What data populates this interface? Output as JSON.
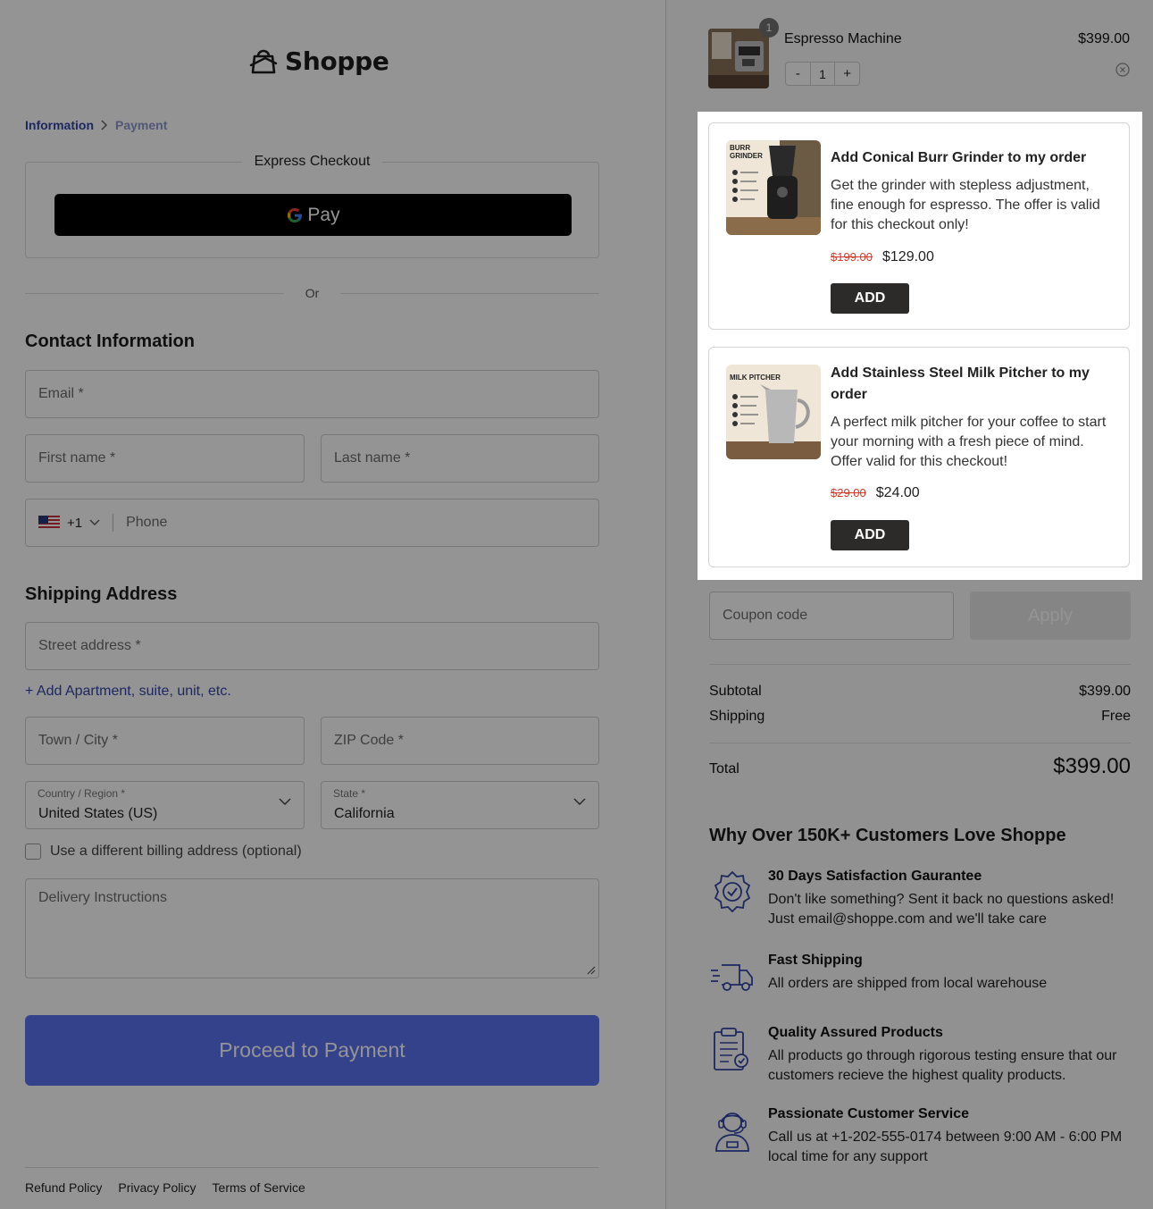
{
  "brand": {
    "name": "Shoppe",
    "accent": "#3346a6"
  },
  "breadcrumb": {
    "step1": "Information",
    "step2": "Payment"
  },
  "express": {
    "title": "Express Checkout",
    "gpay_label": "Pay",
    "or_label": "Or"
  },
  "contact": {
    "title": "Contact Information",
    "email_placeholder": "Email *",
    "first_name_placeholder": "First name *",
    "last_name_placeholder": "Last name *",
    "phone_code": "+1",
    "phone_placeholder": "Phone"
  },
  "shipping": {
    "title": "Shipping Address",
    "street_placeholder": "Street address *",
    "add_apartment": "Add Apartment, suite, unit, etc.",
    "city_placeholder": "Town / City *",
    "zip_placeholder": "ZIP Code *",
    "country_label": "Country / Region *",
    "country_value": "United States (US)",
    "state_label": "State *",
    "state_value": "California",
    "billing_checkbox": "Use a different billing address (optional)",
    "delivery_placeholder": "Delivery Instructions"
  },
  "proceed_button": "Proceed to Payment",
  "footer": {
    "refund": "Refund Policy",
    "privacy": "Privacy Policy",
    "terms": "Terms of Service"
  },
  "cart": {
    "item_name": "Espresso Machine",
    "item_price": "$399.00",
    "item_qty_badge": "1",
    "qty_minus": "-",
    "qty_value": "1",
    "qty_plus": "+"
  },
  "offers": [
    {
      "title": "Add Conical Burr Grinder to my order",
      "desc": "Get the grinder with stepless adjustment, fine enough for espresso. The offer is valid for this checkout only!",
      "old_price": "$199.00",
      "new_price": "$129.00",
      "button": "ADD",
      "image_caption": "BURR GRINDER"
    },
    {
      "title": "Add Stainless Steel Milk Pitcher to my order",
      "desc": "A perfect milk pitcher for your coffee to start your morning with a fresh piece of mind. Offer valid for this checkout!",
      "old_price": "$29.00",
      "new_price": "$24.00",
      "button": "ADD",
      "image_caption": "MILK PITCHER"
    }
  ],
  "coupon": {
    "placeholder": "Coupon code",
    "apply": "Apply"
  },
  "summary": {
    "subtotal_label": "Subtotal",
    "subtotal": "$399.00",
    "shipping_label": "Shipping",
    "shipping": "Free",
    "total_label": "Total",
    "total": "$399.00"
  },
  "why": {
    "title": "Why Over 150K+ Customers Love Shoppe",
    "features": [
      {
        "icon": "badge-check-icon",
        "title": "30 Days Satisfaction Gaurantee",
        "desc": "Don't like something? Sent it back no questions asked! Just email@shoppe.com and we'll take care"
      },
      {
        "icon": "truck-icon",
        "title": "Fast Shipping",
        "desc": "All orders are shipped from local warehouse"
      },
      {
        "icon": "clipboard-check-icon",
        "title": "Quality Assured Products",
        "desc": "All products go through rigorous testing ensure that our customers recieve the highest quality products."
      },
      {
        "icon": "support-agent-icon",
        "title": "Passionate Customer Service",
        "desc": "Call us at +1-202-555-0174 between 9:00 AM - 6:00 PM local time for any support"
      }
    ]
  }
}
